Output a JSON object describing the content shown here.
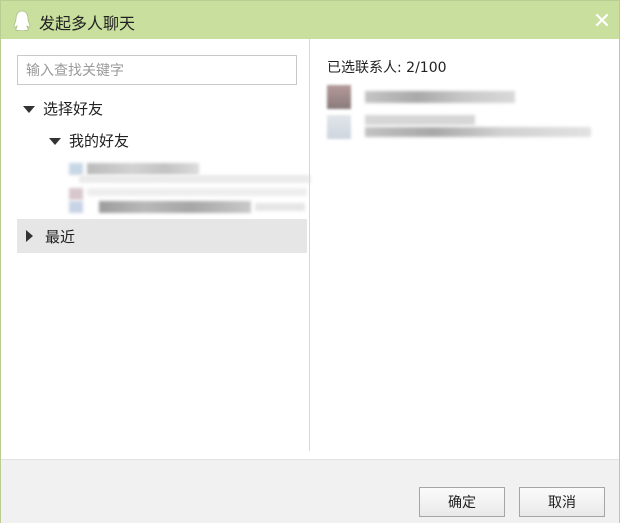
{
  "window": {
    "title": "发起多人聊天",
    "close_icon": "close-icon",
    "app_icon": "qq-penguin-icon"
  },
  "left": {
    "search_placeholder": "输入查找关键字",
    "tree": {
      "root_label": "选择好友",
      "group_label": "我的好友",
      "recent_label": "最近"
    }
  },
  "right": {
    "selected_label": "已选联系人: 2/100"
  },
  "footer": {
    "confirm_label": "确定",
    "cancel_label": "取消"
  },
  "colors": {
    "titlebar": "#c9df9e",
    "recent_row": "#e6e6e6",
    "footer": "#f1f1f1"
  }
}
